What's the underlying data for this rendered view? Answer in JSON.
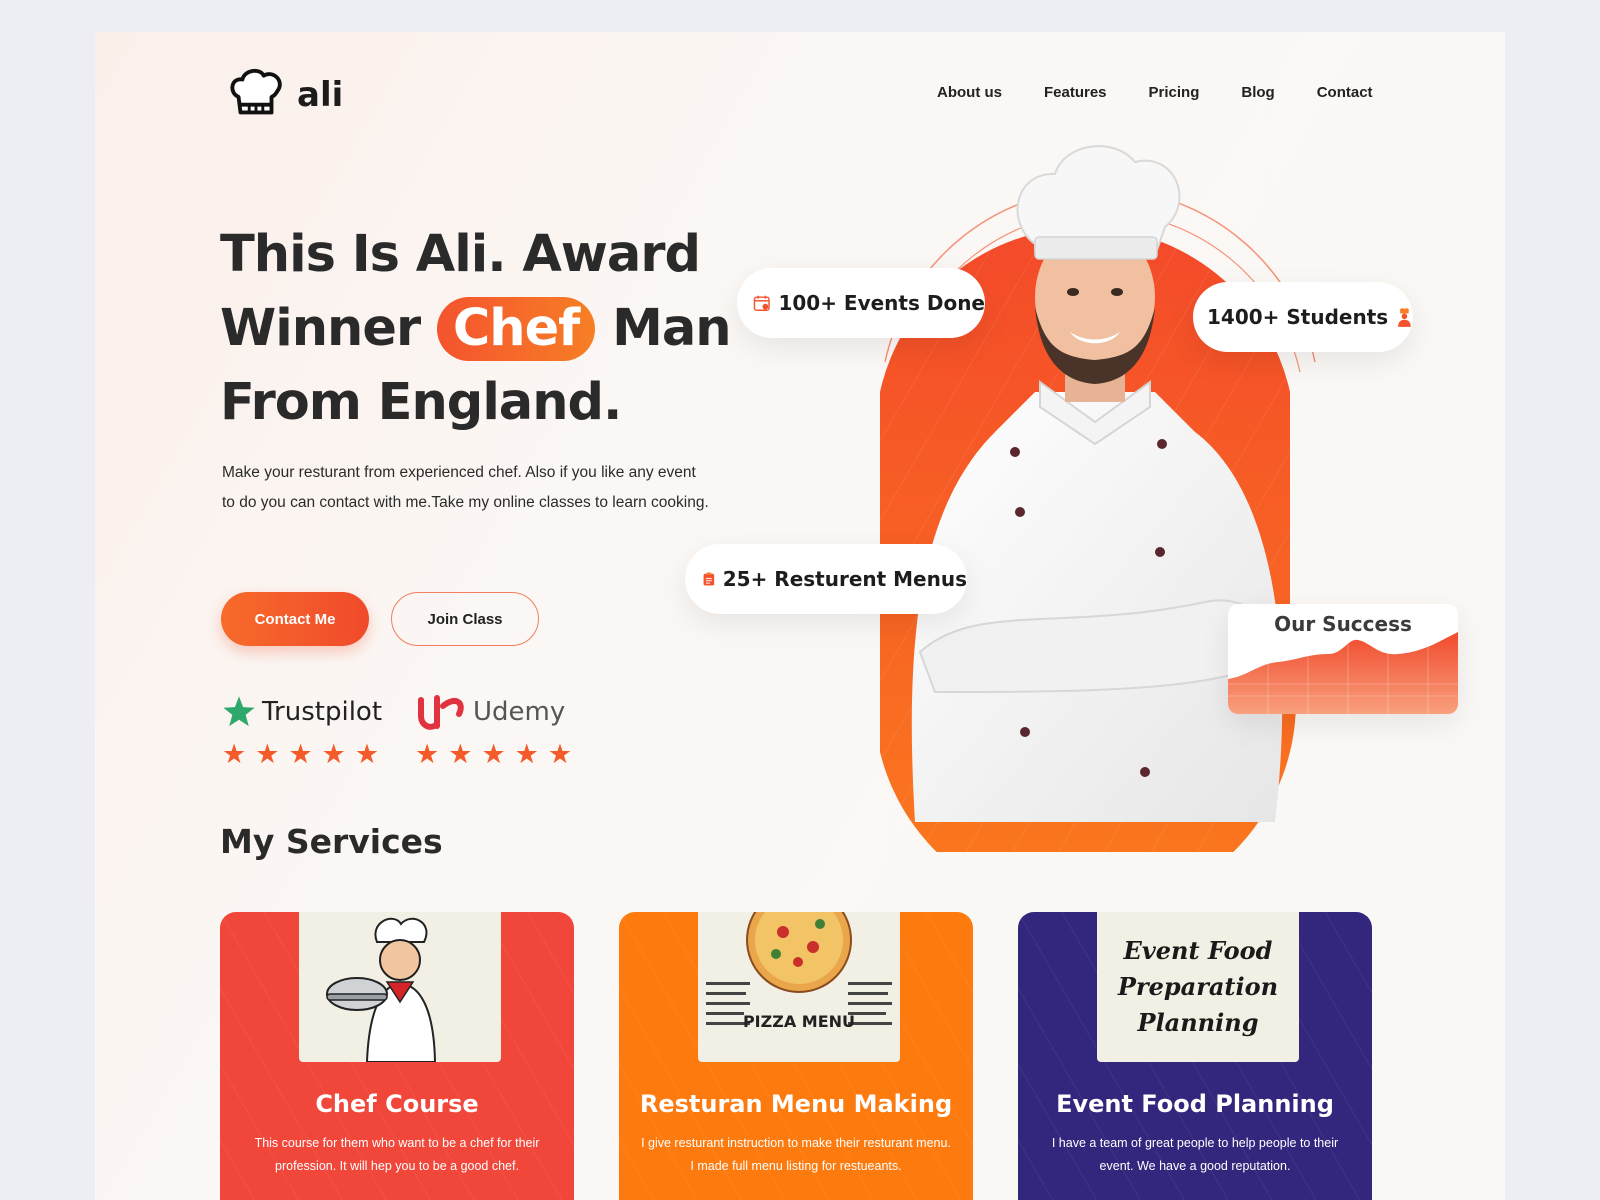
{
  "brand": {
    "name": "ali",
    "logo_icon": "chef-hat-icon"
  },
  "nav": {
    "items": [
      "About us",
      "Features",
      "Pricing",
      "Blog",
      "Contact"
    ]
  },
  "hero": {
    "title_line1": "This Is Ali. Award",
    "title_line2_prefix": "Winner",
    "title_highlight": "Chef",
    "title_line2_suffix": "Man",
    "title_line3": "From England.",
    "description": "Make your resturant from experienced chef. Also if you like any event to do you can contact with me.Take my online classes to learn cooking.",
    "primary_button": "Contact Me",
    "secondary_button": "Join Class",
    "accent_color": "#f4532e"
  },
  "ratings": [
    {
      "brand": "Trustpilot",
      "icon": "trustpilot-star-icon",
      "stars": 5
    },
    {
      "brand": "Udemy",
      "icon": "udemy-logo-icon",
      "stars": 5
    }
  ],
  "stats": {
    "events": {
      "label": "100+ Events Done",
      "icon": "calendar-check-icon"
    },
    "students": {
      "label": "1400+ Students",
      "icon": "chef-student-icon"
    },
    "menus": {
      "label": "25+ Resturent Menus",
      "icon": "clipboard-menu-icon"
    },
    "success": {
      "title": "Our Success"
    }
  },
  "services": {
    "title": "My Services",
    "cards": [
      {
        "title": "Chef Course",
        "description": "This course for them who want to be a chef for their profession. It will hep you to be a good chef.",
        "color": "#f1473b",
        "image": "chef-cartoon"
      },
      {
        "title": "Resturan Menu Making",
        "description": "I give resturant instruction to make their resturant menu. I made full menu listing for restueants.",
        "color": "#fd7a0e",
        "image": "pizza-menu",
        "image_text": "PIZZA MENU"
      },
      {
        "title": "Event Food Planning",
        "description": "I have a team of great people to help people to their event. We have a good reputation.",
        "color": "#33267d",
        "image": "event-food-text",
        "image_text": "Event Food Preparation Planning"
      }
    ]
  }
}
